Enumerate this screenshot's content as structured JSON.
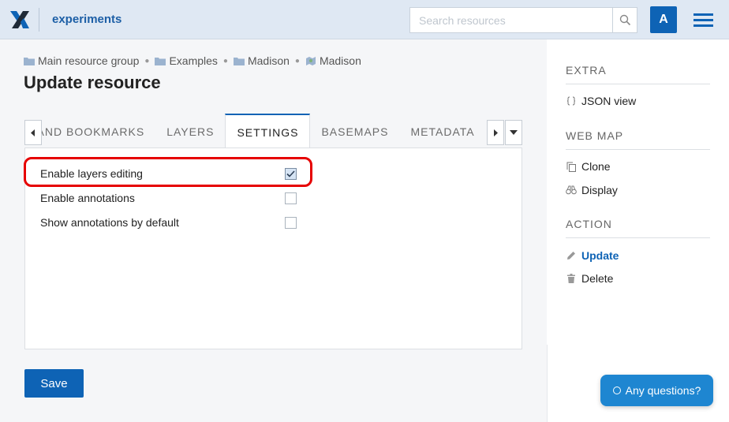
{
  "header": {
    "app_name": "experiments",
    "search_placeholder": "Search resources",
    "avatar_initial": "A"
  },
  "breadcrumb": [
    {
      "label": "Main resource group",
      "icon": "folder-icon"
    },
    {
      "label": "Examples",
      "icon": "folder-icon"
    },
    {
      "label": "Madison",
      "icon": "folder-icon"
    },
    {
      "label": "Madison",
      "icon": "webmap-icon"
    }
  ],
  "page_title": "Update resource",
  "tabs": [
    {
      "label": "NT AND BOOKMARKS",
      "active": false
    },
    {
      "label": "LAYERS",
      "active": false
    },
    {
      "label": "SETTINGS",
      "active": true
    },
    {
      "label": "BASEMAPS",
      "active": false
    },
    {
      "label": "METADATA",
      "active": false
    }
  ],
  "settings": [
    {
      "label": "Enable layers editing",
      "checked": true
    },
    {
      "label": "Enable annotations",
      "checked": false
    },
    {
      "label": "Show annotations by default",
      "checked": false
    }
  ],
  "save_label": "Save",
  "sidebar": {
    "sections": [
      {
        "title": "EXTRA",
        "items": [
          {
            "label": "JSON view",
            "icon": "braces-icon"
          }
        ]
      },
      {
        "title": "WEB MAP",
        "items": [
          {
            "label": "Clone",
            "icon": "copy-icon"
          },
          {
            "label": "Display",
            "icon": "binoculars-icon"
          }
        ]
      },
      {
        "title": "ACTION",
        "items": [
          {
            "label": "Update",
            "icon": "pencil-icon",
            "active": true
          },
          {
            "label": "Delete",
            "icon": "trash-icon"
          }
        ]
      }
    ]
  },
  "help_label": "Any questions?",
  "colors": {
    "accent": "#0e63b5",
    "header_bg": "#dfe8f3",
    "highlight": "#e60000"
  }
}
